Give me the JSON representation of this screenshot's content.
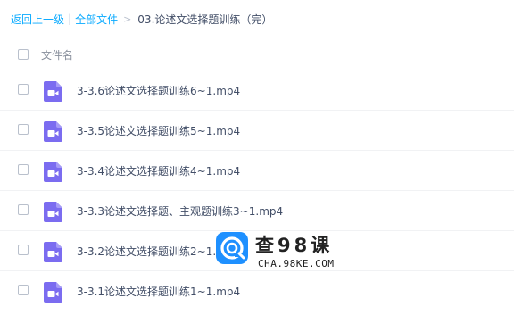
{
  "breadcrumb": {
    "back": "返回上一级",
    "separator": "|",
    "all_files": "全部文件",
    "arrow": ">",
    "current": "03.论述文选择题训练（完）"
  },
  "list_header": {
    "column_name": "文件名"
  },
  "files": [
    {
      "name": "3-3.6论述文选择题训练6~1.mp4",
      "icon": "video-file-icon"
    },
    {
      "name": "3-3.5论述文选择题训练5~1.mp4",
      "icon": "video-file-icon"
    },
    {
      "name": "3-3.4论述文选择题训练4~1.mp4",
      "icon": "video-file-icon"
    },
    {
      "name": "3-3.3论述文选择题、主观题训练3~1.mp4",
      "icon": "video-file-icon"
    },
    {
      "name": "3-3.2论述文选择题训练2~1.mp4",
      "icon": "video-file-icon"
    },
    {
      "name": "3-3.1论述文选择题训练1~1.mp4",
      "icon": "video-file-icon"
    }
  ],
  "watermark": {
    "title": "查98课",
    "url": "CHA.98KE.COM"
  },
  "colors": {
    "link": "#09aaff",
    "text": "#424e67",
    "muted": "#888f9c",
    "video_icon": "#7b6cf0",
    "watermark_logo": "#1e90ff"
  }
}
